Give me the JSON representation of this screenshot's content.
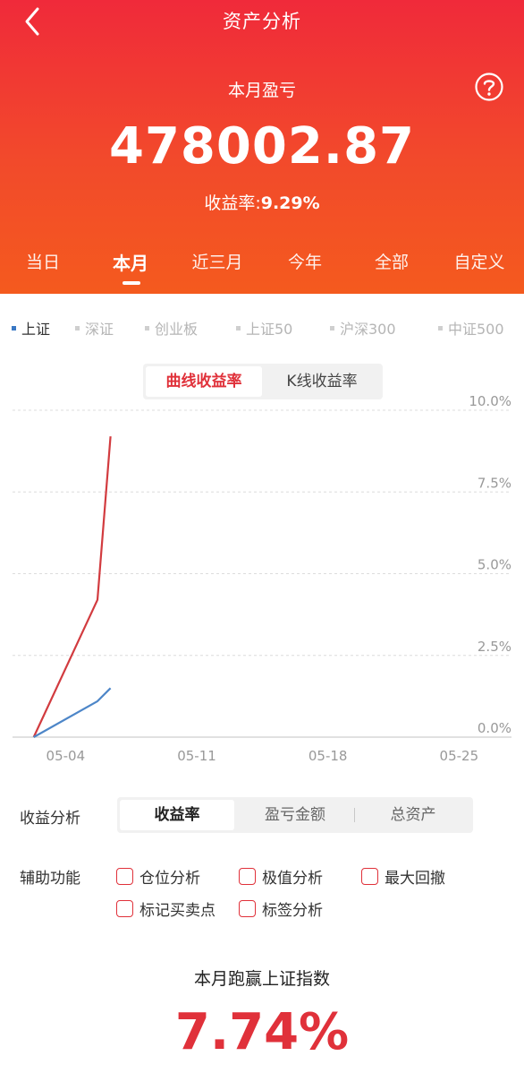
{
  "header": {
    "title": "资产分析",
    "pl_label": "本月盈亏",
    "pl_value": "478002.87",
    "rate_label": "收益率:",
    "rate_value": "9.29%"
  },
  "period_tabs": [
    {
      "label": "当日",
      "active": false
    },
    {
      "label": "本月",
      "active": true
    },
    {
      "label": "近三月",
      "active": false
    },
    {
      "label": "今年",
      "active": false
    },
    {
      "label": "全部",
      "active": false
    },
    {
      "label": "自定义",
      "active": false
    }
  ],
  "indices": [
    {
      "label": "上证",
      "active": true
    },
    {
      "label": "深证",
      "active": false
    },
    {
      "label": "创业板",
      "active": false
    },
    {
      "label": "上证50",
      "active": false
    },
    {
      "label": "沪深300",
      "active": false
    },
    {
      "label": "中证500",
      "active": false
    }
  ],
  "chart_toggle": {
    "curve": "曲线收益率",
    "kline": "K线收益率"
  },
  "chart_data": {
    "type": "line",
    "x_ticks": [
      "05-04",
      "05-11",
      "05-18",
      "05-25"
    ],
    "y_ticks": [
      "10.0%",
      "7.5%",
      "5.0%",
      "2.5%",
      "0.0%"
    ],
    "ylim": [
      0,
      10
    ],
    "grid": true,
    "series": [
      {
        "color": "#d23b3f",
        "x": [
          0,
          3.4,
          4.1
        ],
        "y": [
          0,
          4.2,
          9.2
        ]
      },
      {
        "color": "#4d86c8",
        "x": [
          0,
          3.4,
          4.1
        ],
        "y": [
          0,
          1.1,
          1.5
        ]
      }
    ],
    "x_range": [
      -1.8,
      25.5
    ],
    "x_tick_positions": [
      1.7,
      8.7,
      15.7,
      22.7
    ]
  },
  "analysis": {
    "label": "收益分析",
    "options": [
      "收益率",
      "盈亏金额",
      "总资产"
    ]
  },
  "aux": {
    "label": "辅助功能",
    "options": [
      "仓位分析",
      "极值分析",
      "最大回撤",
      "标记买卖点",
      "标签分析"
    ]
  },
  "beat": {
    "label": "本月跑赢上证指数",
    "value": "7.74%"
  },
  "colors": {
    "accent_red": "#e0313a",
    "header_top": "#f02a3a",
    "header_bottom": "#f45a1e",
    "index_blue": "#3a78c4"
  }
}
